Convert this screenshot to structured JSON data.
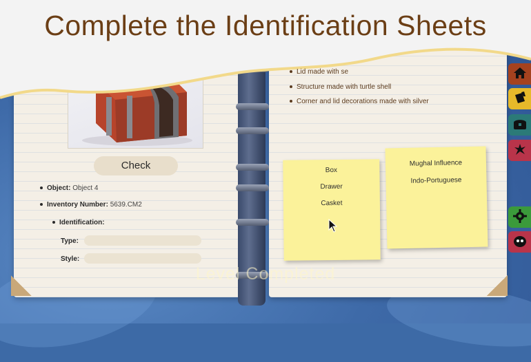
{
  "title": "Complete the Identification Sheets",
  "left_page": {
    "check_button": "Check",
    "object_label": "Object:",
    "object_value": "Object 4",
    "inventory_label": "Inventory Number:",
    "inventory_value": "5639.CM2",
    "identification_label": "Identification:",
    "type_label": "Type:",
    "style_label": "Style:"
  },
  "right_page": {
    "facts": [
      "Lid made with se",
      "Structure made with turtle shell",
      "Corner and lid decorations made with silver"
    ]
  },
  "sticky_type": {
    "options": [
      "Box",
      "Drawer",
      "Casket"
    ]
  },
  "sticky_style": {
    "options": [
      "Mughal Influence",
      "Indo-Portuguese"
    ]
  },
  "overlay_text": "Level Completed",
  "side_tabs": [
    {
      "icon": "home-icon",
      "color": "#a5421f"
    },
    {
      "icon": "bookmark-icon",
      "color": "#e7b92a"
    },
    {
      "icon": "chest-icon",
      "color": "#2b7a78"
    },
    {
      "icon": "splat-icon",
      "color": "#b9344a"
    },
    {
      "icon": "gear-icon",
      "color": "#3b9a3b"
    },
    {
      "icon": "character-icon",
      "color": "#b9344a"
    }
  ]
}
